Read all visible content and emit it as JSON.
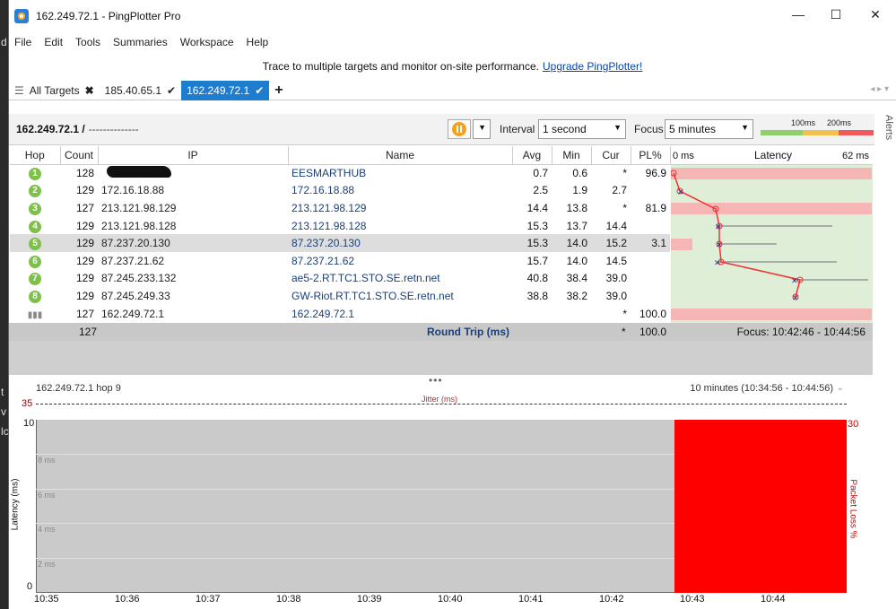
{
  "background_fragments": [
    "d",
    "t",
    "v",
    "lc"
  ],
  "window": {
    "title": "162.249.72.1 - PingPlotter Pro",
    "minimize": "—",
    "maximize": "☐",
    "close": "✕"
  },
  "menu": [
    "File",
    "Edit",
    "Tools",
    "Summaries",
    "Workspace",
    "Help"
  ],
  "promo": {
    "text": "Trace to multiple targets and monitor on-site performance.",
    "link": "Upgrade PingPlotter!"
  },
  "tabs": {
    "all_targets": "All Targets",
    "items": [
      {
        "label": "185.40.65.1",
        "active": false
      },
      {
        "label": "162.249.72.1",
        "active": true
      }
    ],
    "add": "+"
  },
  "control": {
    "target": "162.249.72.1 /",
    "target_suffix": "--------------",
    "interval_label": "Interval",
    "interval_value": "1 second",
    "focus_label": "Focus",
    "focus_value": "5 minutes",
    "scale": {
      "t100": "100ms",
      "t200": "200ms"
    },
    "alerts": "Alerts"
  },
  "columns": [
    "Hop",
    "Count",
    "IP",
    "Name",
    "Avg",
    "Min",
    "Cur",
    "PL%"
  ],
  "latency_header": {
    "left": "0 ms",
    "title": "Latency",
    "right": "62 ms"
  },
  "hops": [
    {
      "hop": "1",
      "count": "128",
      "ip": "",
      "name": "EESMARTHUB",
      "avg": "0.7",
      "min": "0.6",
      "cur": "*",
      "pl": "96.9"
    },
    {
      "hop": "2",
      "count": "129",
      "ip": "172.16.18.88",
      "name": "172.16.18.88",
      "avg": "2.5",
      "min": "1.9",
      "cur": "2.7",
      "pl": ""
    },
    {
      "hop": "3",
      "count": "127",
      "ip": "213.121.98.129",
      "name": "213.121.98.129",
      "avg": "14.4",
      "min": "13.8",
      "cur": "*",
      "pl": "81.9"
    },
    {
      "hop": "4",
      "count": "129",
      "ip": "213.121.98.128",
      "name": "213.121.98.128",
      "avg": "15.3",
      "min": "13.7",
      "cur": "14.4",
      "pl": ""
    },
    {
      "hop": "5",
      "count": "129",
      "ip": "87.237.20.130",
      "name": "87.237.20.130",
      "avg": "15.3",
      "min": "14.0",
      "cur": "15.2",
      "pl": "3.1"
    },
    {
      "hop": "6",
      "count": "129",
      "ip": "87.237.21.62",
      "name": "87.237.21.62",
      "avg": "15.7",
      "min": "14.0",
      "cur": "14.5",
      "pl": ""
    },
    {
      "hop": "7",
      "count": "129",
      "ip": "87.245.233.132",
      "name": "ae5-2.RT.TC1.STO.SE.retn.net",
      "avg": "40.8",
      "min": "38.4",
      "cur": "39.0",
      "pl": ""
    },
    {
      "hop": "8",
      "count": "129",
      "ip": "87.245.249.33",
      "name": "GW-Riot.RT.TC1.STO.SE.retn.net",
      "avg": "38.8",
      "min": "38.2",
      "cur": "39.0",
      "pl": ""
    },
    {
      "hop": "",
      "count": "127",
      "ip": "162.249.72.1",
      "name": "162.249.72.1",
      "avg": "",
      "min": "",
      "cur": "*",
      "pl": "100.0"
    }
  ],
  "round_trip": {
    "count": "127",
    "label": "Round Trip (ms)",
    "cur": "*",
    "pl": "100.0",
    "focus": "Focus: 10:42:46 - 10:44:56"
  },
  "graph": {
    "title": "162.249.72.1 hop 9",
    "range": "10 minutes (10:34:56 - 10:44:56)",
    "jitter_label": "Jitter (ms)",
    "jitter_value": "35",
    "y_left_label": "Latency (ms)",
    "y_right_label": "Packet Loss %",
    "y_ticks": [
      "10",
      "8 ms",
      "6 ms",
      "4 ms",
      "2 ms",
      "0"
    ],
    "right_tick": "30",
    "x_ticks": [
      "10:35",
      "10:36",
      "10:37",
      "10:38",
      "10:39",
      "10:40",
      "10:41",
      "10:42",
      "10:43",
      "10:44"
    ],
    "loss_color": "#ff0000"
  }
}
